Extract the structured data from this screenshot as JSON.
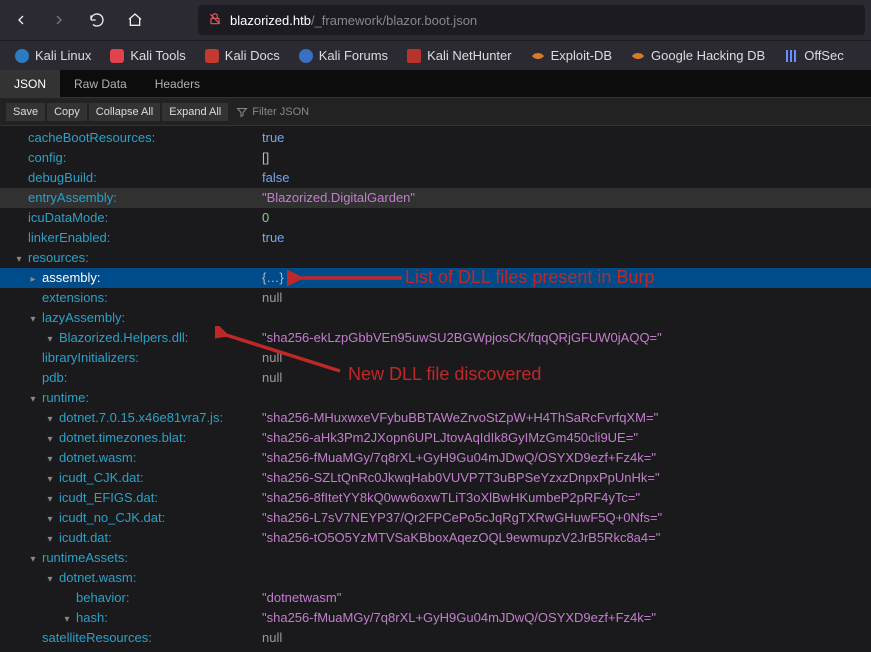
{
  "url": {
    "host": "blazorized.htb",
    "path": "/_framework/blazor.boot.json"
  },
  "bookmarks": [
    {
      "label": "Kali Linux",
      "icon": "kali"
    },
    {
      "label": "Kali Tools",
      "icon": "kali-tools"
    },
    {
      "label": "Kali Docs",
      "icon": "kali-docs"
    },
    {
      "label": "Kali Forums",
      "icon": "kali-forums"
    },
    {
      "label": "Kali NetHunter",
      "icon": "nethunter"
    },
    {
      "label": "Exploit-DB",
      "icon": "edb"
    },
    {
      "label": "Google Hacking DB",
      "icon": "ghdb"
    },
    {
      "label": "OffSec",
      "icon": "offsec"
    }
  ],
  "tabs": [
    {
      "label": "JSON",
      "active": true
    },
    {
      "label": "Raw Data",
      "active": false
    },
    {
      "label": "Headers",
      "active": false
    }
  ],
  "toolbar": {
    "save": "Save",
    "copy": "Copy",
    "collapse": "Collapse All",
    "expand": "Expand All",
    "filter_placeholder": "Filter JSON"
  },
  "json": {
    "cacheBootResources": "true",
    "config": "[]",
    "debugBuild": "false",
    "entryAssembly": "\"Blazorized.DigitalGarden\"",
    "icuDataMode": "0",
    "linkerEnabled": "true",
    "resources": "",
    "assembly": "{…}",
    "extensions": "null",
    "lazyAssembly": "",
    "blazorized_helpers_dll": "\"sha256-ekLzpGbbVEn95uwSU2BGWpjosCK/fqqQRjGFUW0jAQQ=\"",
    "libraryInitializers": "null",
    "pdb": "null",
    "runtime": "",
    "dotnet_js": "\"sha256-MHuxwxeVFybuBBTAWeZrvoStZpW+H4ThSaRcFvrfqXM=\"",
    "dotnet_tz": "\"sha256-aHk3Pm2JXopn6UPLJtovAqIdIk8GyIMzGm450cli9UE=\"",
    "dotnet_wasm": "\"sha256-fMuaMGy/7q8rXL+GyH9Gu04mJDwQ/OSYXD9ezf+Fz4k=\"",
    "icudt_cjk": "\"sha256-SZLtQnRc0JkwqHab0VUVP7T3uBPSeYzxzDnpxPpUnHk=\"",
    "icudt_efigs": "\"sha256-8fItetYY8kQ0ww6oxwTLiT3oXlBwHKumbeP2pRF4yTc=\"",
    "icudt_nocjk": "\"sha256-L7sV7NEYP37/Qr2FPCePo5cJqRgTXRwGHuwF5Q+0Nfs=\"",
    "icudt": "\"sha256-tO5O5YzMTVSaKBboxAqezOQL9ewmupzV2JrB5Rkc8a4=\"",
    "runtimeAssets": "",
    "ra_wasm": "",
    "behavior": "\"dotnetwasm\"",
    "hash": "\"sha256-fMuaMGy/7q8rXL+GyH9Gu04mJDwQ/OSYXD9ezf+Fz4k=\"",
    "satelliteResources": "null"
  },
  "keys": {
    "cacheBootResources": "cacheBootResources",
    "config": "config",
    "debugBuild": "debugBuild",
    "entryAssembly": "entryAssembly",
    "icuDataMode": "icuDataMode",
    "linkerEnabled": "linkerEnabled",
    "resources": "resources",
    "assembly": "assembly",
    "extensions": "extensions",
    "lazyAssembly": "lazyAssembly",
    "blazorized_helpers_dll": "Blazorized.Helpers.dll",
    "libraryInitializers": "libraryInitializers",
    "pdb": "pdb",
    "runtime": "runtime",
    "dotnet_js": "dotnet.7.0.15.x46e81vra7.js",
    "dotnet_tz": "dotnet.timezones.blat",
    "dotnet_wasm": "dotnet.wasm",
    "icudt_cjk": "icudt_CJK.dat",
    "icudt_efigs": "icudt_EFIGS.dat",
    "icudt_nocjk": "icudt_no_CJK.dat",
    "icudt": "icudt.dat",
    "runtimeAssets": "runtimeAssets",
    "ra_wasm": "dotnet.wasm",
    "behavior": "behavior",
    "hash": "hash",
    "satelliteResources": "satelliteResources"
  },
  "annotations": {
    "list": "List of DLL files present in Burp",
    "newdll": "New DLL file discovered"
  }
}
